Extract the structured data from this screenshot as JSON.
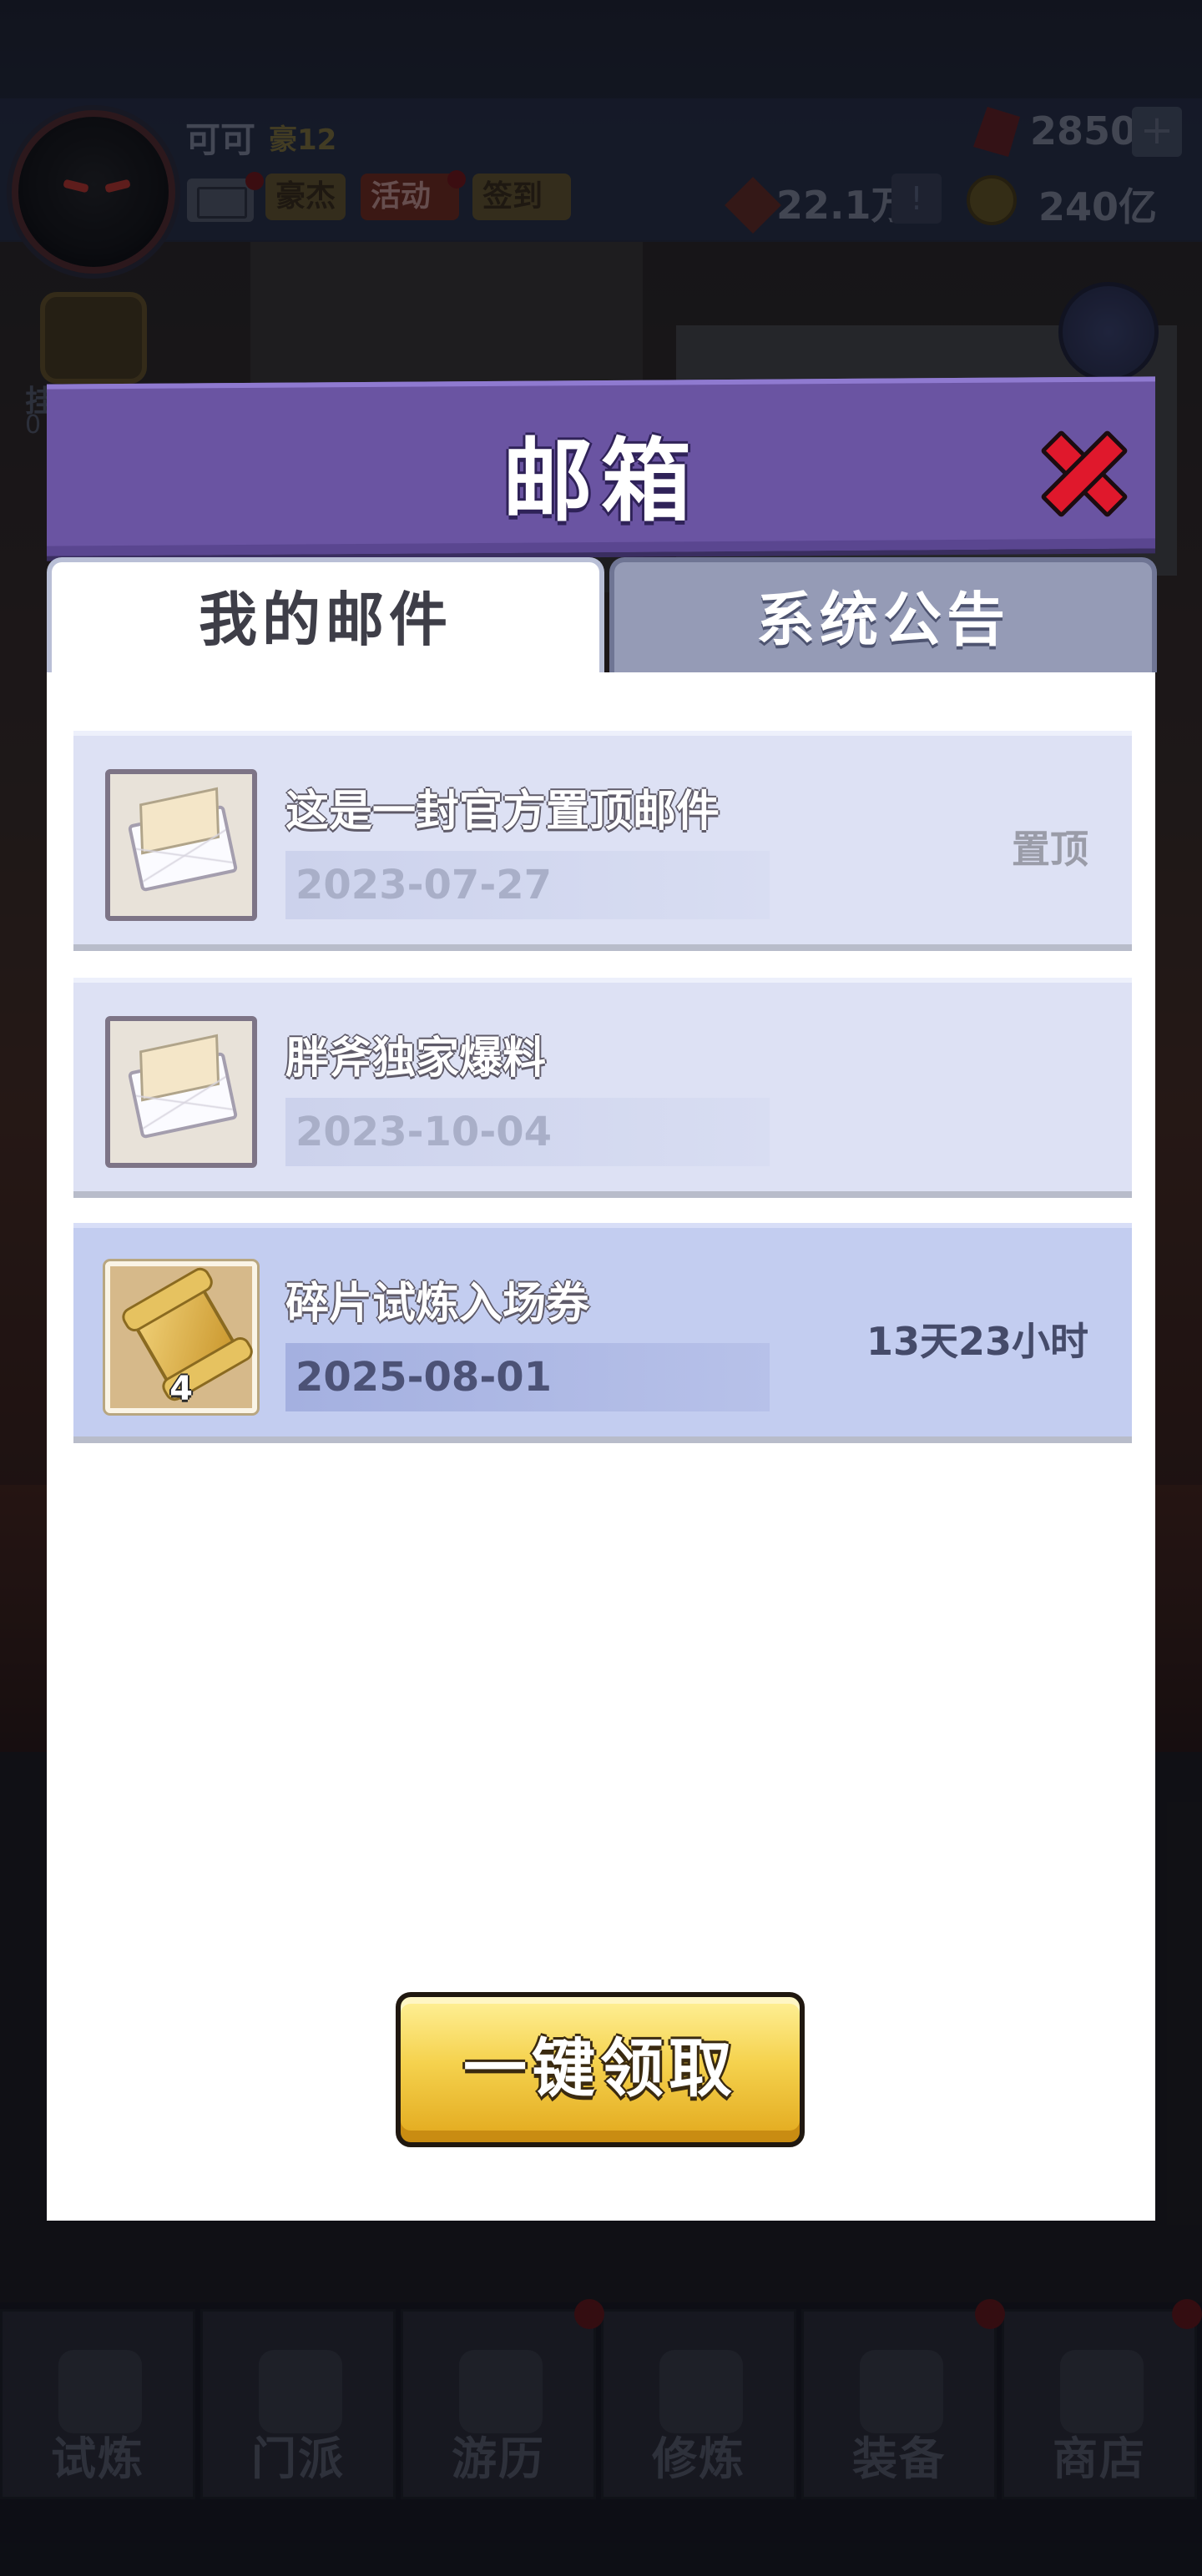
{
  "hud": {
    "player_name": "可可",
    "player_rank": "豪12",
    "tags": [
      "豪杰",
      "活动",
      "签到"
    ],
    "power": "22.1万",
    "power_info": "!",
    "gems": "2850",
    "gem_plus": "+",
    "coins": "240亿"
  },
  "side": {
    "chest_label": "挂机收益",
    "chest_timer": "0"
  },
  "modal": {
    "title": "邮箱",
    "tabs": [
      {
        "label": "我的邮件",
        "active": true
      },
      {
        "label": "系统公告",
        "active": false
      }
    ],
    "mails": [
      {
        "icon": "envelope-icon",
        "title": "这是一封官方置顶邮件",
        "date": "2023-07-27",
        "tag": "置顶"
      },
      {
        "icon": "envelope-icon",
        "title": "胖斧独家爆料",
        "date": "2023-10-04",
        "tag": ""
      },
      {
        "icon": "scroll-icon",
        "count": "4",
        "title": "碎片试炼入场券",
        "date": "2025-08-01",
        "tag": "13天23小时"
      }
    ],
    "claim_all": "一键领取"
  },
  "bottom_nav": [
    "试炼",
    "门派",
    "游历",
    "修炼",
    "装备",
    "商店"
  ],
  "colors": {
    "modal_header": "#6a54a2",
    "close_red": "#e0182c",
    "claim_yellow": "#f5d24e",
    "mail_row": "#dde1f4",
    "mail_row_highlight": "#c3cdf0"
  }
}
